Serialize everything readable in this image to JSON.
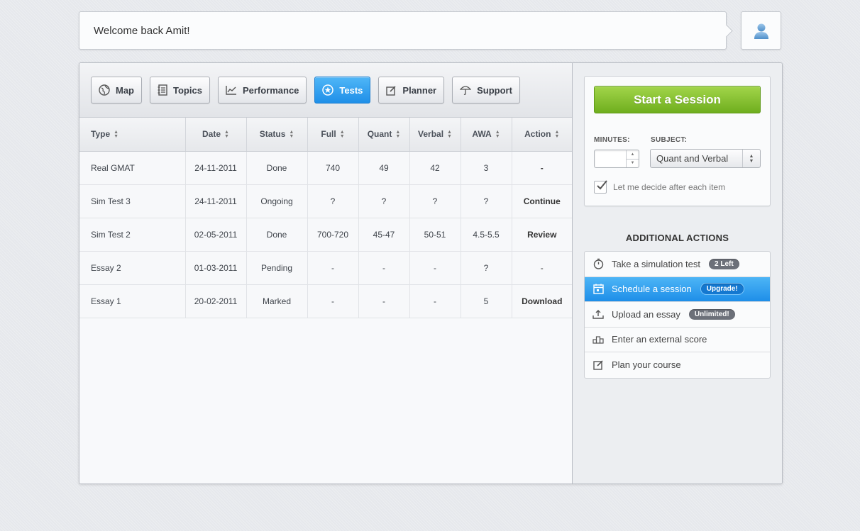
{
  "header": {
    "welcome": "Welcome back Amit!",
    "avatar_icon": "user-icon"
  },
  "toolbar": {
    "buttons": [
      {
        "label": "Map",
        "icon": "globe-icon"
      },
      {
        "label": "Topics",
        "icon": "notebook-icon"
      },
      {
        "label": "Performance",
        "icon": "line-chart-icon"
      },
      {
        "label": "Tests",
        "icon": "star-circle-icon",
        "active": true
      },
      {
        "label": "Planner",
        "icon": "edit-icon"
      },
      {
        "label": "Support",
        "icon": "umbrella-icon"
      }
    ]
  },
  "table": {
    "columns": [
      "Type",
      "Date",
      "Status",
      "Full",
      "Quant",
      "Verbal",
      "AWA",
      "Action"
    ],
    "rows": [
      [
        "Real GMAT",
        "24-11-2011",
        "Done",
        "740",
        "49",
        "42",
        "3",
        "-"
      ],
      [
        "Sim Test 3",
        "24-11-2011",
        "Ongoing",
        "?",
        "?",
        "?",
        "?",
        "Continue"
      ],
      [
        "Sim Test 2",
        "02-05-2011",
        "Done",
        "700-720",
        "45-47",
        "50-51",
        "4.5-5.5",
        "Review"
      ],
      [
        "Essay 2",
        "01-03-2011",
        "Pending",
        "-",
        "-",
        "-",
        "?",
        "-"
      ],
      [
        "Essay 1",
        "20-02-2011",
        "Marked",
        "-",
        "-",
        "-",
        "5",
        "Download"
      ]
    ]
  },
  "session": {
    "start_label": "Start a Session",
    "minutes_label": "MINUTES:",
    "minutes_value": "",
    "subject_label": "SUBJECT:",
    "subject_value": "Quant and Verbal",
    "checkbox_label": "Let me decide after each item",
    "checkbox_checked": true
  },
  "additional": {
    "title": "ADDITIONAL ACTIONS",
    "items": [
      {
        "label": "Take a simulation test",
        "badge": "2 Left",
        "icon": "stopwatch-icon"
      },
      {
        "label": "Schedule a session",
        "badge": "Upgrade!",
        "icon": "calendar-icon",
        "active": true
      },
      {
        "label": "Upload an essay",
        "badge": "Unlimited!",
        "icon": "upload-icon"
      },
      {
        "label": "Enter an external score",
        "badge": "",
        "icon": "podium-icon"
      },
      {
        "label": "Plan your course",
        "badge": "",
        "icon": "edit-icon"
      }
    ]
  },
  "colors": {
    "accent_blue": "#1f8fe8",
    "start_green": "#7ab82a"
  }
}
